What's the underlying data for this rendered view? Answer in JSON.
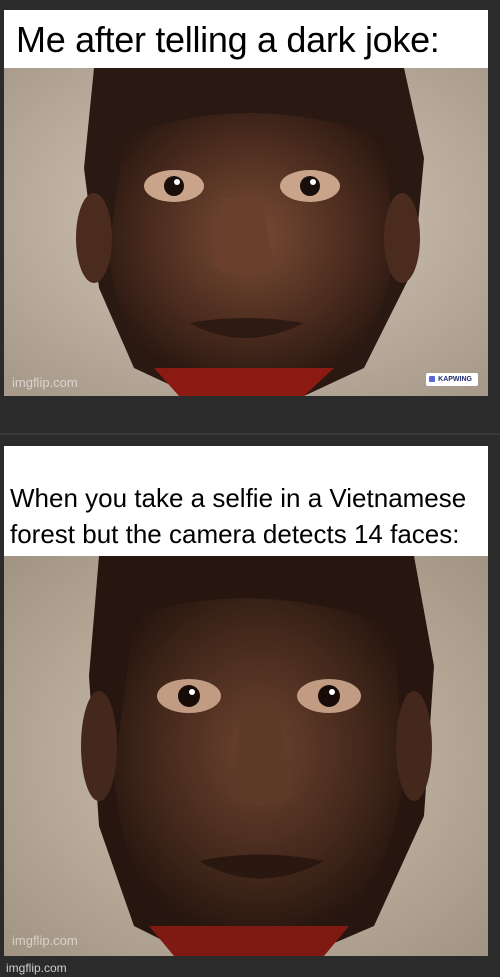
{
  "panels": [
    {
      "caption": "Me after telling a dark joke:",
      "watermark": "imgflip.com",
      "badge": "KAPWING"
    },
    {
      "caption": "When you take a selfie in a Vietnamese forest but the camera detects 14 faces:",
      "watermark": "imgflip.com"
    }
  ],
  "footer": {
    "watermark": "imgflip.com"
  }
}
